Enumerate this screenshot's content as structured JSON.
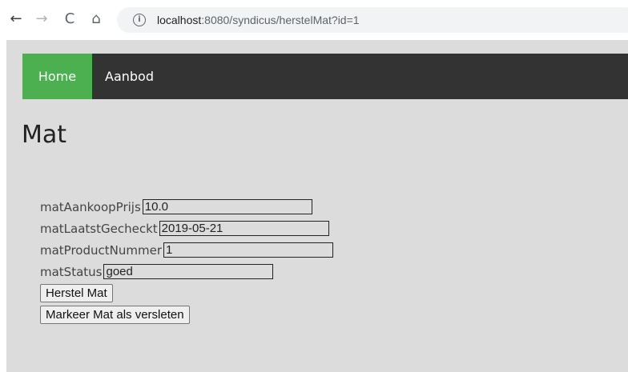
{
  "browser": {
    "url_host": "localhost",
    "url_path": ":8080/syndicus/herstelMat?id=1",
    "back_glyph": "←",
    "forward_glyph": "→",
    "reload_glyph": "C",
    "home_glyph": "⌂",
    "info_glyph": "i"
  },
  "navbar": {
    "items": [
      {
        "label": "Home",
        "active": true
      },
      {
        "label": "Aanbod",
        "active": false
      }
    ],
    "active_color": "#4caf50",
    "background_color": "#333333"
  },
  "page": {
    "title": "Mat",
    "background_color": "#dcdcdc"
  },
  "form": {
    "fields": [
      {
        "label": "matAankoopPrijs",
        "value": "10.0"
      },
      {
        "label": "matLaatstGecheckt",
        "value": "2019-05-21"
      },
      {
        "label": "matProductNummer",
        "value": "1"
      },
      {
        "label": "matStatus",
        "value": "goed"
      }
    ],
    "buttons": {
      "herstel": "Herstel Mat",
      "markeer": "Markeer Mat als versleten"
    }
  }
}
